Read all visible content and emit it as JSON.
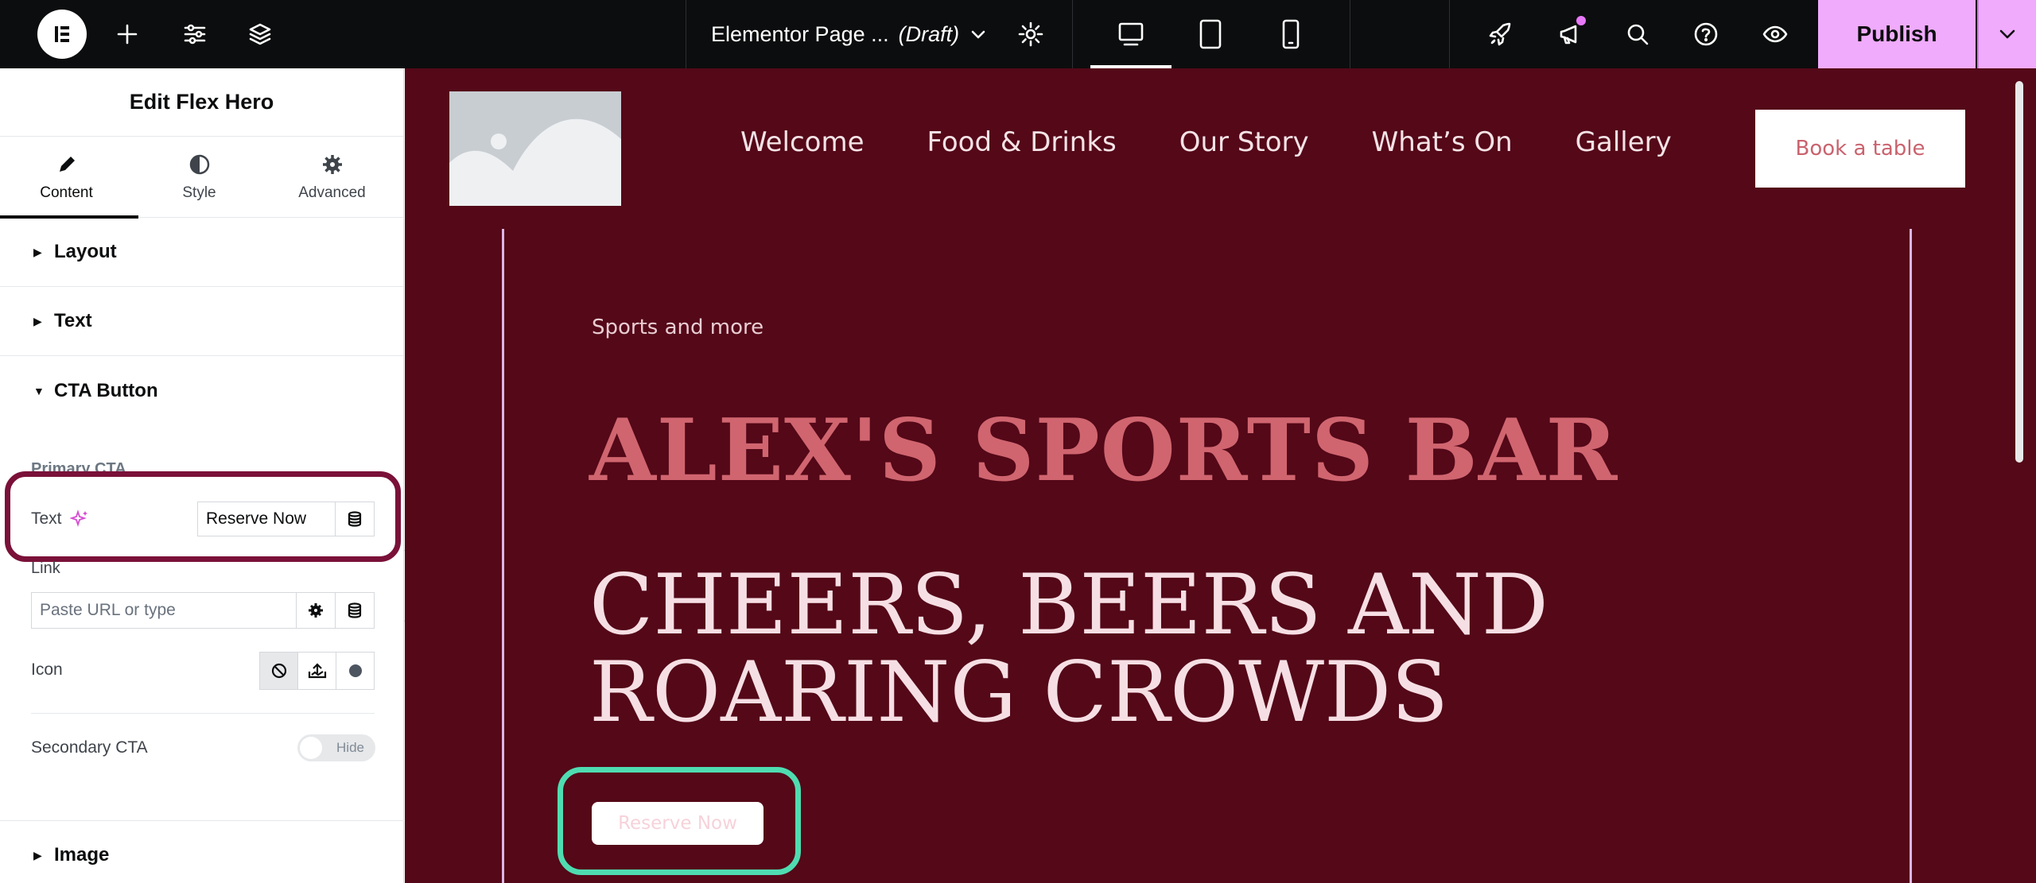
{
  "topbar": {
    "page_title": "Elementor Page ...",
    "page_status": "(Draft)",
    "publish_label": "Publish"
  },
  "panel": {
    "title": "Edit Flex Hero",
    "tabs": [
      {
        "label": "Content",
        "icon": "pencil-icon",
        "active": true
      },
      {
        "label": "Style",
        "icon": "half-circle-icon",
        "active": false
      },
      {
        "label": "Advanced",
        "icon": "gear-icon",
        "active": false
      }
    ],
    "sections": {
      "layout": "Layout",
      "text": "Text",
      "cta": "CTA Button",
      "image": "Image"
    },
    "cta": {
      "primary_heading": "Primary CTA",
      "text_label": "Text",
      "text_value": "Reserve Now",
      "link_label": "Link",
      "link_placeholder": "Paste URL or type",
      "icon_label": "Icon",
      "secondary_label": "Secondary CTA",
      "secondary_toggle": "Hide"
    }
  },
  "site": {
    "nav": [
      "Welcome",
      "Food & Drinks",
      "Our Story",
      "What’s On",
      "Gallery"
    ],
    "book_button": "Book a table",
    "eyebrow": "Sports and more",
    "headline": "ALEX'S SPORTS BAR",
    "subhead": "CHEERS, BEERS AND ROARING CROWDS",
    "cta_button": "Reserve Now"
  },
  "colors": {
    "topbar_bg": "#0c0d0e",
    "publish_bg": "#f0abfc",
    "canvas_bg": "#540818",
    "headline": "#d0656f",
    "panel_highlight": "#7a1138",
    "canvas_highlight": "#4fdcb1"
  }
}
